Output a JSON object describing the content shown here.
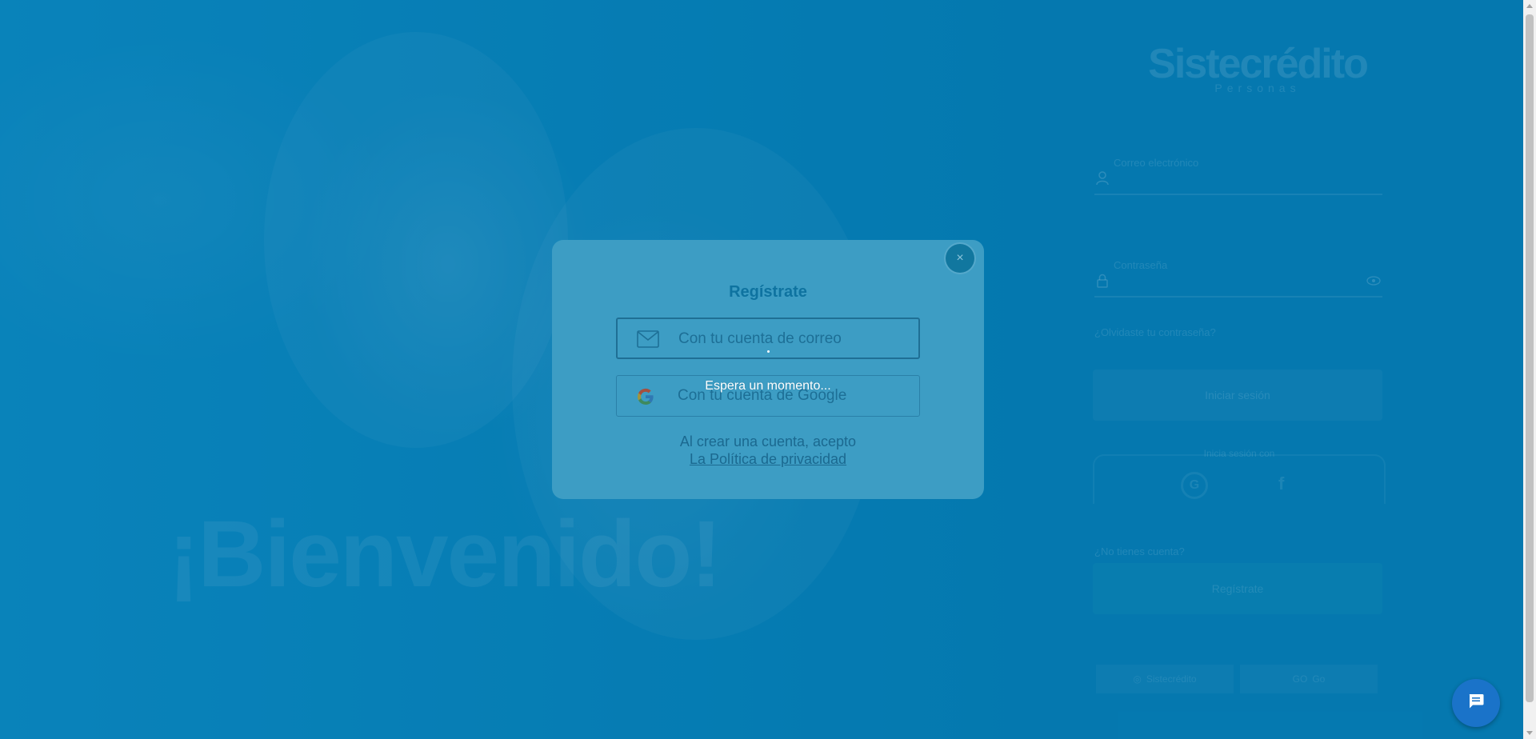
{
  "hero": {
    "welcome": "¡Bienvenido!"
  },
  "login": {
    "brand_name": "Sistecrédito",
    "brand_sub": "Personas",
    "fields": [
      {
        "label": "Correo electrónico",
        "icon": "user-icon"
      },
      {
        "label": "Contraseña",
        "icon": "lock-icon"
      }
    ],
    "forgot": "¿Olvidaste tu contraseña?",
    "login_button": "Iniciar sesión",
    "social_title": "Inicia sesión con",
    "no_account": "¿No tienes cuenta?",
    "register_button": "Regístrate",
    "footer_buttons": [
      "Sistecrédito",
      "Go"
    ]
  },
  "modal": {
    "title": "Regístrate",
    "options": [
      {
        "label": "Con tu cuenta de correo",
        "icon": "mail-icon"
      },
      {
        "label": "Con tu cuenta de Google",
        "icon": "google-icon"
      }
    ],
    "terms_text": "Al crear una cuenta, acepto",
    "terms_link": "La Política de privacidad",
    "close_label": "×",
    "loading": "Espera un momento..."
  },
  "colors": {
    "background": "#0a82b6",
    "modal": "#3d9dc4",
    "title": "#0e73a0",
    "chat_fab": "#1a73c9"
  }
}
